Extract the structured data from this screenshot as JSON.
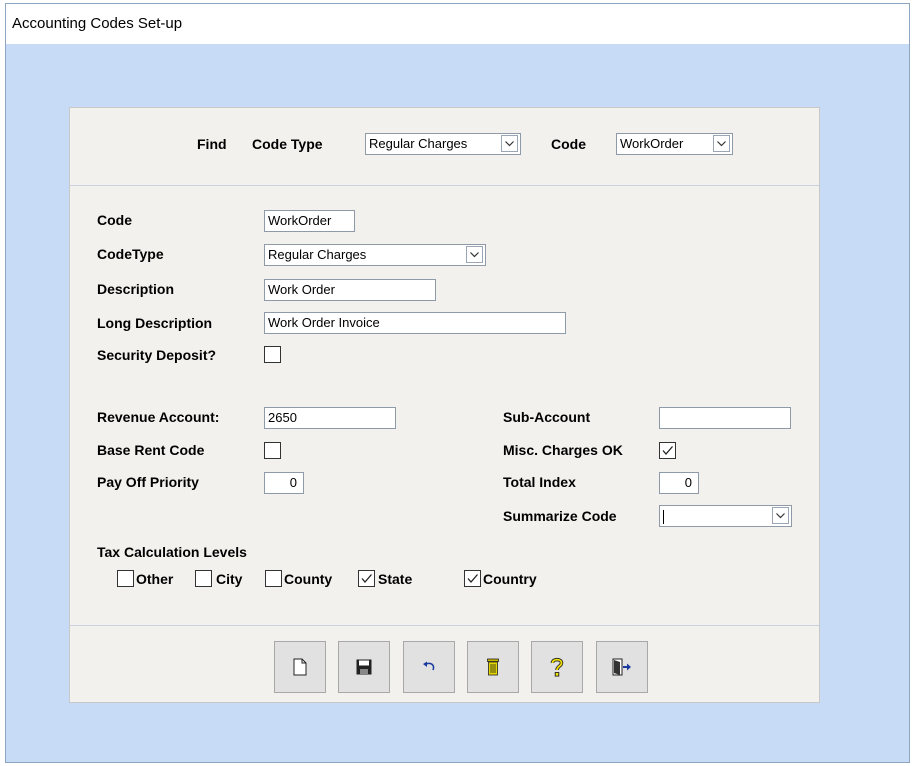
{
  "window": {
    "title": "Accounting Codes Set-up"
  },
  "find": {
    "find_label": "Find",
    "code_type_label": "Code Type",
    "code_type_value": "Regular Charges",
    "code_label": "Code",
    "code_value": "WorkOrder"
  },
  "form": {
    "code_label": "Code",
    "code_value": "WorkOrder",
    "codetype_label": "CodeType",
    "codetype_value": "Regular Charges",
    "description_label": "Description",
    "description_value": "Work Order",
    "long_description_label": "Long Description",
    "long_description_value": "Work Order Invoice",
    "security_deposit_label": "Security Deposit?",
    "security_deposit_checked": false,
    "revenue_account_label": "Revenue Account:",
    "revenue_account_value": "2650",
    "sub_account_label": "Sub-Account",
    "sub_account_value": "",
    "base_rent_code_label": "Base Rent Code",
    "base_rent_code_checked": false,
    "misc_charges_label": "Misc. Charges OK",
    "misc_charges_checked": true,
    "pay_off_priority_label": "Pay Off Priority",
    "pay_off_priority_value": "0",
    "total_index_label": "Total Index",
    "total_index_value": "0",
    "summarize_code_label": "Summarize Code",
    "summarize_code_value": ""
  },
  "tax": {
    "heading": "Tax Calculation Levels",
    "levels": [
      {
        "label": "Other",
        "checked": false
      },
      {
        "label": "City",
        "checked": false
      },
      {
        "label": "County",
        "checked": false
      },
      {
        "label": "State",
        "checked": true
      },
      {
        "label": "Country",
        "checked": true
      }
    ]
  },
  "toolbar": {
    "icons": [
      "new-document-icon",
      "save-icon",
      "undo-icon",
      "delete-icon",
      "help-icon",
      "exit-icon"
    ]
  },
  "colors": {
    "background": "#c7dbf7",
    "panel": "#f2f1ee",
    "button": "#e1e1e1"
  }
}
